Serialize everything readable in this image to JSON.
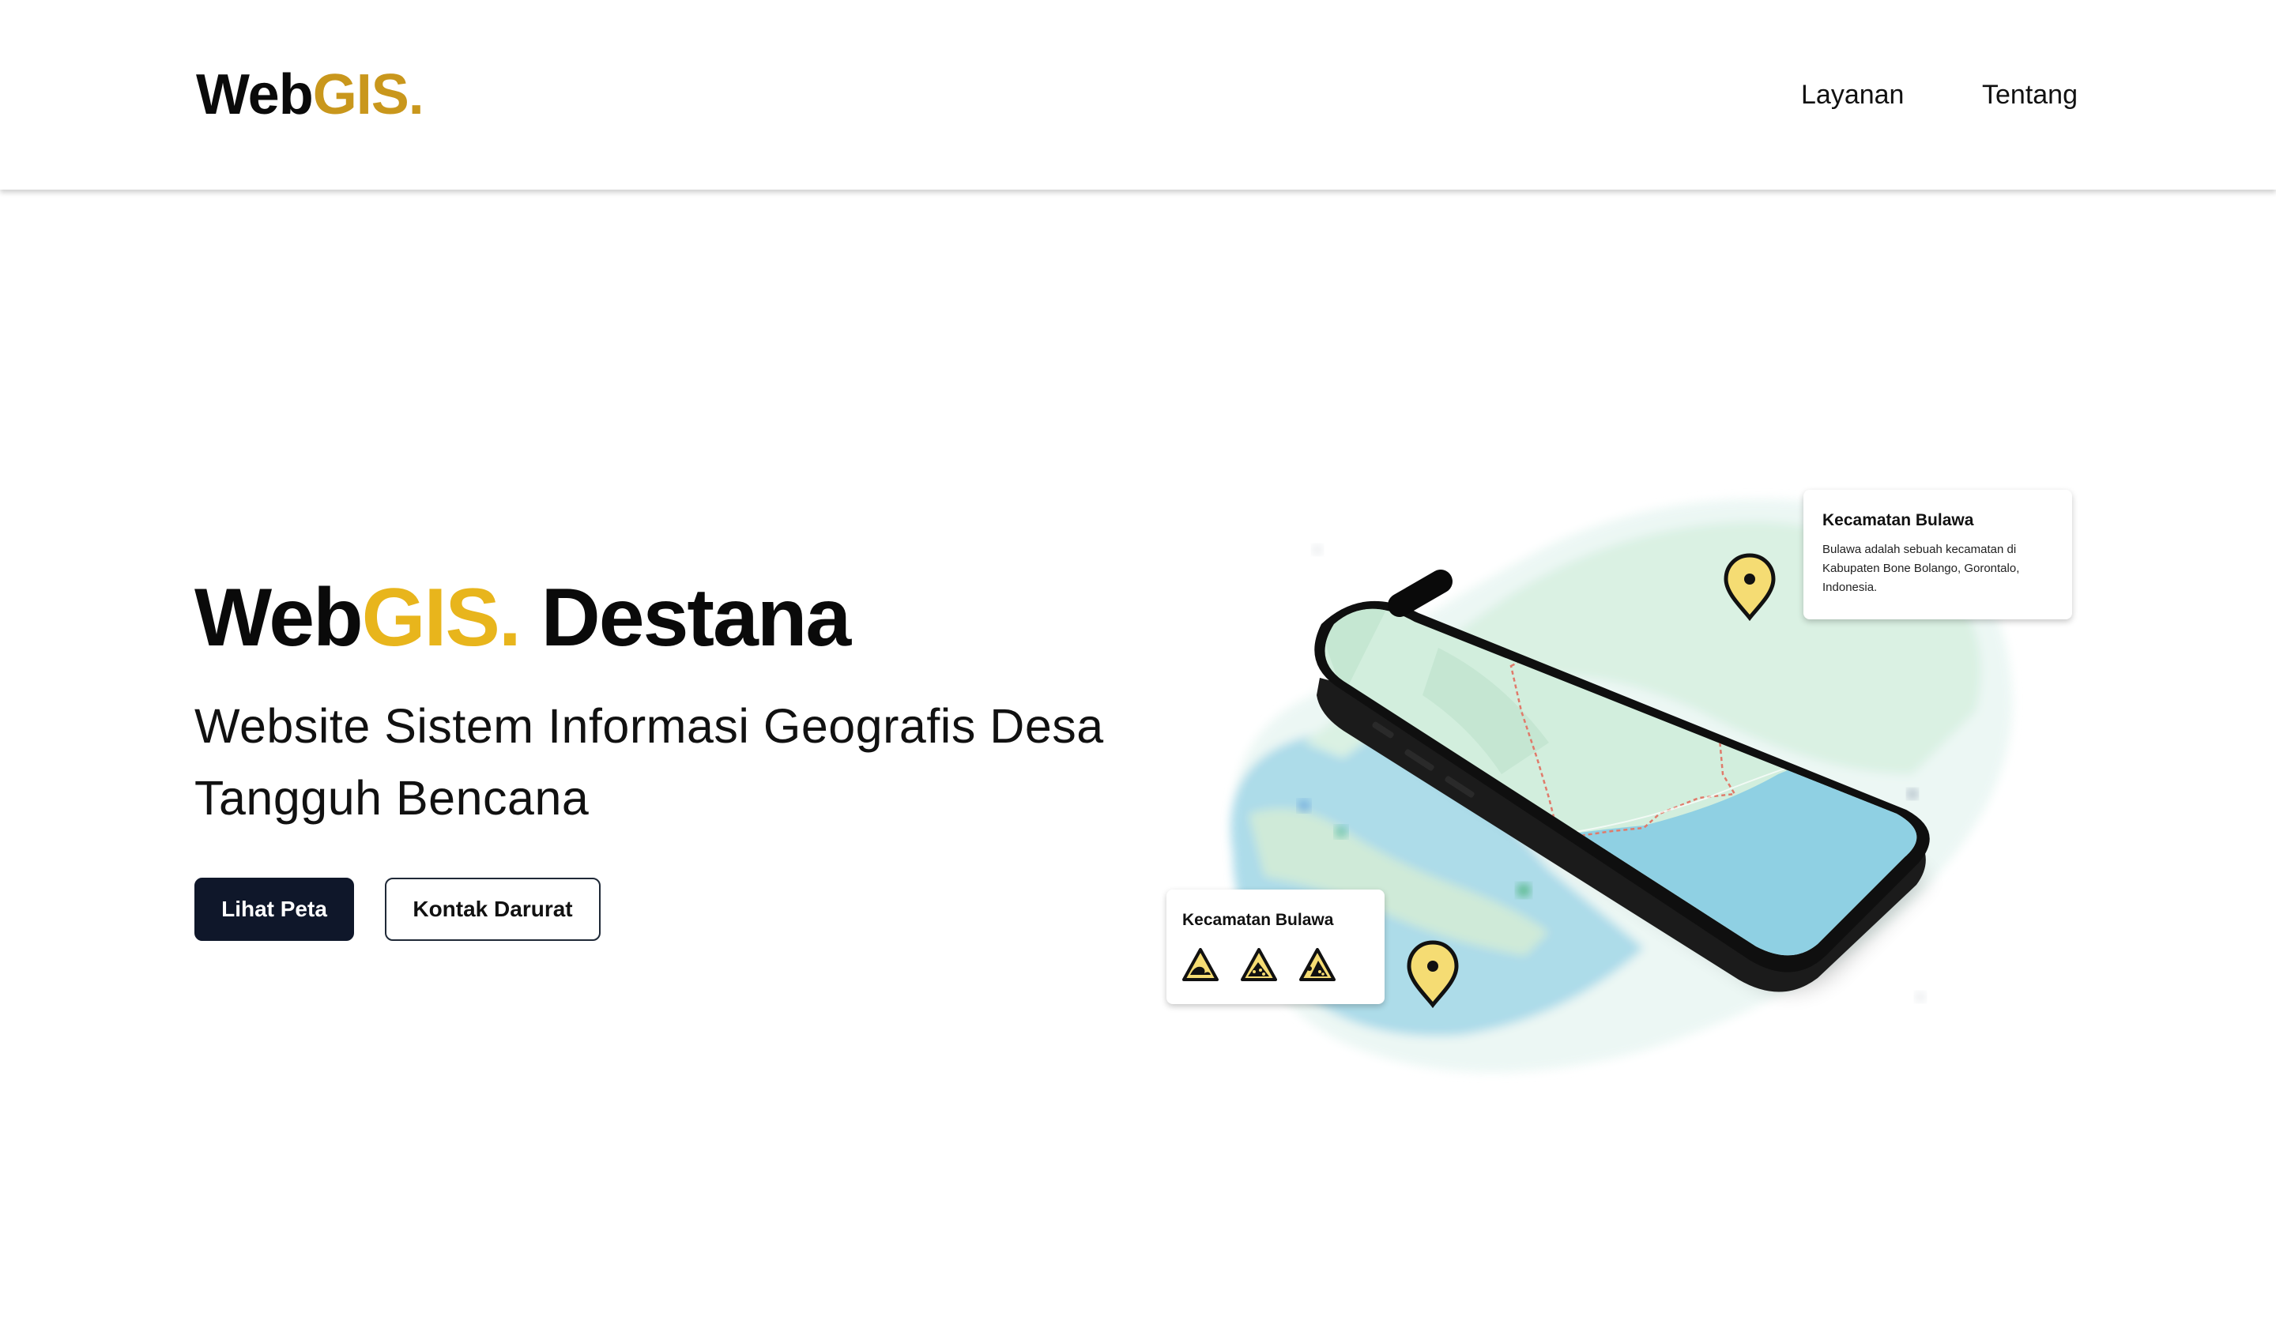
{
  "brand": {
    "logo_main": "Web",
    "logo_accent": "GIS."
  },
  "nav": {
    "items": [
      {
        "label": "Layanan"
      },
      {
        "label": "Tentang"
      }
    ]
  },
  "hero": {
    "title_main": "Web",
    "title_accent": "GIS.",
    "title_rest": "Destana",
    "subtitle": "Website Sistem Informasi Geografis Desa Tangguh Bencana",
    "primary_button": "Lihat Peta",
    "secondary_button": "Kontak Darurat"
  },
  "illustration": {
    "info_card": {
      "title": "Kecamatan Bulawa",
      "description": "Bulawa adalah sebuah kecamatan di Kabupaten Bone Bolango, Gorontalo, Indonesia."
    },
    "hazard_card": {
      "title": "Kecamatan Bulawa",
      "icons": [
        "tsunami-hazard-icon",
        "landslide-hazard-icon",
        "rockfall-hazard-icon"
      ]
    }
  },
  "colors": {
    "logo_accent": "#c9971c",
    "title_accent": "#e8b51c",
    "primary_button_bg": "#0f172a",
    "map_land": "#cfeede",
    "map_water": "#8fd0e3",
    "pin_yellow": "#f5dc73"
  }
}
